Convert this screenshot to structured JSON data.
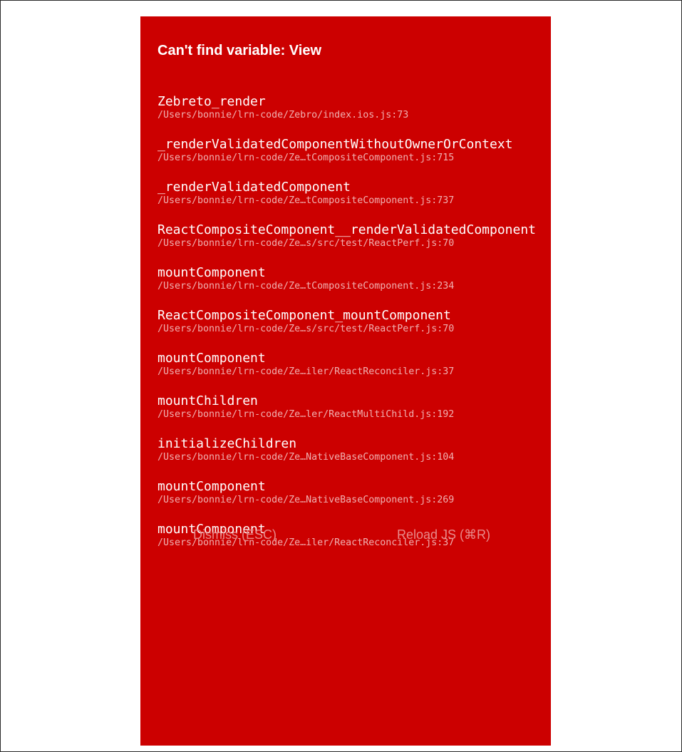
{
  "error": {
    "title": "Can't find variable: View"
  },
  "stack": [
    {
      "fn": "Zebreto_render",
      "loc": "/Users/bonnie/lrn-code/Zebro/index.ios.js:73"
    },
    {
      "fn": "_renderValidatedComponentWithoutOwnerOrContext",
      "loc": "/Users/bonnie/lrn-code/Ze…tCompositeComponent.js:715"
    },
    {
      "fn": "_renderValidatedComponent",
      "loc": "/Users/bonnie/lrn-code/Ze…tCompositeComponent.js:737"
    },
    {
      "fn": "ReactCompositeComponent__renderValidatedComponent",
      "loc": "/Users/bonnie/lrn-code/Ze…s/src/test/ReactPerf.js:70"
    },
    {
      "fn": "mountComponent",
      "loc": "/Users/bonnie/lrn-code/Ze…tCompositeComponent.js:234"
    },
    {
      "fn": "ReactCompositeComponent_mountComponent",
      "loc": "/Users/bonnie/lrn-code/Ze…s/src/test/ReactPerf.js:70"
    },
    {
      "fn": "mountComponent",
      "loc": "/Users/bonnie/lrn-code/Ze…iler/ReactReconciler.js:37"
    },
    {
      "fn": "mountChildren",
      "loc": "/Users/bonnie/lrn-code/Ze…ler/ReactMultiChild.js:192"
    },
    {
      "fn": "initializeChildren",
      "loc": "/Users/bonnie/lrn-code/Ze…NativeBaseComponent.js:104"
    },
    {
      "fn": "mountComponent",
      "loc": "/Users/bonnie/lrn-code/Ze…NativeBaseComponent.js:269"
    },
    {
      "fn": "mountComponent",
      "loc": "/Users/bonnie/lrn-code/Ze…iler/ReactReconciler.js:37"
    }
  ],
  "buttons": {
    "dismiss": "Dismiss (ESC)",
    "reload": "Reload JS (⌘R)"
  },
  "colors": {
    "background": "#cc0000",
    "text": "#ffffff",
    "location_text": "#f0b0b0",
    "button_text": "#e88a8a"
  }
}
